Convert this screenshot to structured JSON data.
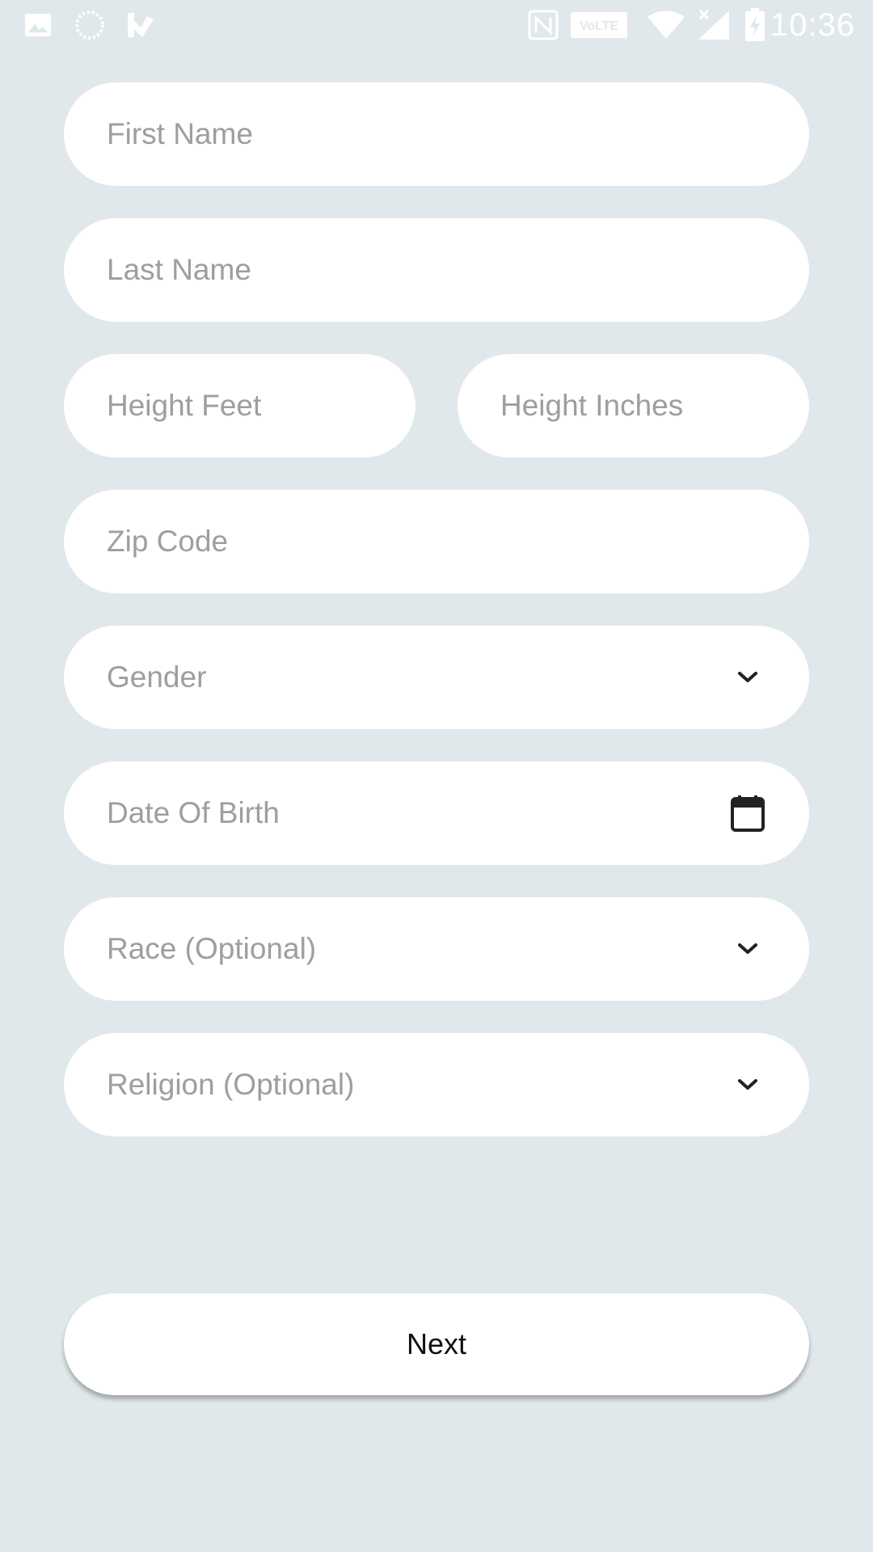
{
  "status_bar": {
    "time": "10:36",
    "left_icons": [
      "image-icon",
      "loading-circle-icon",
      "checkmark-flag-icon"
    ],
    "right_icons": [
      "nfc-icon",
      "volte-icon",
      "wifi-icon",
      "signal-no-data-icon",
      "battery-charging-icon"
    ],
    "volte_label": "VoLTE"
  },
  "form": {
    "first_name": {
      "placeholder": "First Name",
      "value": ""
    },
    "last_name": {
      "placeholder": "Last Name",
      "value": ""
    },
    "height_feet": {
      "placeholder": "Height Feet",
      "value": ""
    },
    "height_inches": {
      "placeholder": "Height Inches",
      "value": ""
    },
    "zip_code": {
      "placeholder": "Zip Code",
      "value": ""
    },
    "gender": {
      "label": "Gender",
      "icon": "chevron-down-icon"
    },
    "date_of_birth": {
      "label": "Date Of Birth",
      "icon": "calendar-icon"
    },
    "race": {
      "label": "Race (Optional)",
      "icon": "chevron-down-icon"
    },
    "religion": {
      "label": "Religion (Optional)",
      "icon": "chevron-down-icon"
    }
  },
  "actions": {
    "next_label": "Next"
  },
  "colors": {
    "background": "#e0e8eb",
    "field_background": "#ffffff",
    "placeholder_text": "#9e9e9e",
    "status_icons": "#ffffff"
  }
}
